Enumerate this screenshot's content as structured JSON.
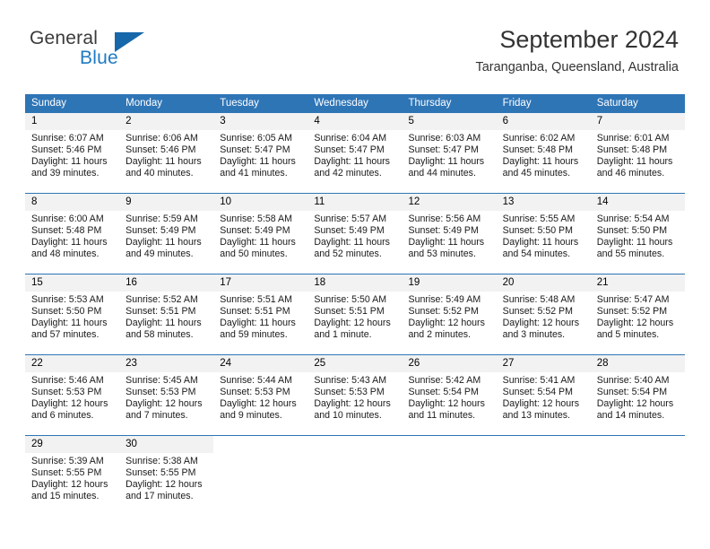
{
  "brand": {
    "name_top": "General",
    "name_bottom": "Blue",
    "accent_color": "#1f7ac4",
    "triangle_color": "#1767ab"
  },
  "header": {
    "month_title": "September 2024",
    "location": "Taranganba, Queensland, Australia"
  },
  "theme": {
    "header_blue": "#2e75b6",
    "daynum_band": "#f2f2f2"
  },
  "weekday_headers": [
    "Sunday",
    "Monday",
    "Tuesday",
    "Wednesday",
    "Thursday",
    "Friday",
    "Saturday"
  ],
  "weeks": [
    [
      {
        "day": "1",
        "sunrise": "Sunrise: 6:07 AM",
        "sunset": "Sunset: 5:46 PM",
        "daylight": "Daylight: 11 hours and 39 minutes."
      },
      {
        "day": "2",
        "sunrise": "Sunrise: 6:06 AM",
        "sunset": "Sunset: 5:46 PM",
        "daylight": "Daylight: 11 hours and 40 minutes."
      },
      {
        "day": "3",
        "sunrise": "Sunrise: 6:05 AM",
        "sunset": "Sunset: 5:47 PM",
        "daylight": "Daylight: 11 hours and 41 minutes."
      },
      {
        "day": "4",
        "sunrise": "Sunrise: 6:04 AM",
        "sunset": "Sunset: 5:47 PM",
        "daylight": "Daylight: 11 hours and 42 minutes."
      },
      {
        "day": "5",
        "sunrise": "Sunrise: 6:03 AM",
        "sunset": "Sunset: 5:47 PM",
        "daylight": "Daylight: 11 hours and 44 minutes."
      },
      {
        "day": "6",
        "sunrise": "Sunrise: 6:02 AM",
        "sunset": "Sunset: 5:48 PM",
        "daylight": "Daylight: 11 hours and 45 minutes."
      },
      {
        "day": "7",
        "sunrise": "Sunrise: 6:01 AM",
        "sunset": "Sunset: 5:48 PM",
        "daylight": "Daylight: 11 hours and 46 minutes."
      }
    ],
    [
      {
        "day": "8",
        "sunrise": "Sunrise: 6:00 AM",
        "sunset": "Sunset: 5:48 PM",
        "daylight": "Daylight: 11 hours and 48 minutes."
      },
      {
        "day": "9",
        "sunrise": "Sunrise: 5:59 AM",
        "sunset": "Sunset: 5:49 PM",
        "daylight": "Daylight: 11 hours and 49 minutes."
      },
      {
        "day": "10",
        "sunrise": "Sunrise: 5:58 AM",
        "sunset": "Sunset: 5:49 PM",
        "daylight": "Daylight: 11 hours and 50 minutes."
      },
      {
        "day": "11",
        "sunrise": "Sunrise: 5:57 AM",
        "sunset": "Sunset: 5:49 PM",
        "daylight": "Daylight: 11 hours and 52 minutes."
      },
      {
        "day": "12",
        "sunrise": "Sunrise: 5:56 AM",
        "sunset": "Sunset: 5:49 PM",
        "daylight": "Daylight: 11 hours and 53 minutes."
      },
      {
        "day": "13",
        "sunrise": "Sunrise: 5:55 AM",
        "sunset": "Sunset: 5:50 PM",
        "daylight": "Daylight: 11 hours and 54 minutes."
      },
      {
        "day": "14",
        "sunrise": "Sunrise: 5:54 AM",
        "sunset": "Sunset: 5:50 PM",
        "daylight": "Daylight: 11 hours and 55 minutes."
      }
    ],
    [
      {
        "day": "15",
        "sunrise": "Sunrise: 5:53 AM",
        "sunset": "Sunset: 5:50 PM",
        "daylight": "Daylight: 11 hours and 57 minutes."
      },
      {
        "day": "16",
        "sunrise": "Sunrise: 5:52 AM",
        "sunset": "Sunset: 5:51 PM",
        "daylight": "Daylight: 11 hours and 58 minutes."
      },
      {
        "day": "17",
        "sunrise": "Sunrise: 5:51 AM",
        "sunset": "Sunset: 5:51 PM",
        "daylight": "Daylight: 11 hours and 59 minutes."
      },
      {
        "day": "18",
        "sunrise": "Sunrise: 5:50 AM",
        "sunset": "Sunset: 5:51 PM",
        "daylight": "Daylight: 12 hours and 1 minute."
      },
      {
        "day": "19",
        "sunrise": "Sunrise: 5:49 AM",
        "sunset": "Sunset: 5:52 PM",
        "daylight": "Daylight: 12 hours and 2 minutes."
      },
      {
        "day": "20",
        "sunrise": "Sunrise: 5:48 AM",
        "sunset": "Sunset: 5:52 PM",
        "daylight": "Daylight: 12 hours and 3 minutes."
      },
      {
        "day": "21",
        "sunrise": "Sunrise: 5:47 AM",
        "sunset": "Sunset: 5:52 PM",
        "daylight": "Daylight: 12 hours and 5 minutes."
      }
    ],
    [
      {
        "day": "22",
        "sunrise": "Sunrise: 5:46 AM",
        "sunset": "Sunset: 5:53 PM",
        "daylight": "Daylight: 12 hours and 6 minutes."
      },
      {
        "day": "23",
        "sunrise": "Sunrise: 5:45 AM",
        "sunset": "Sunset: 5:53 PM",
        "daylight": "Daylight: 12 hours and 7 minutes."
      },
      {
        "day": "24",
        "sunrise": "Sunrise: 5:44 AM",
        "sunset": "Sunset: 5:53 PM",
        "daylight": "Daylight: 12 hours and 9 minutes."
      },
      {
        "day": "25",
        "sunrise": "Sunrise: 5:43 AM",
        "sunset": "Sunset: 5:53 PM",
        "daylight": "Daylight: 12 hours and 10 minutes."
      },
      {
        "day": "26",
        "sunrise": "Sunrise: 5:42 AM",
        "sunset": "Sunset: 5:54 PM",
        "daylight": "Daylight: 12 hours and 11 minutes."
      },
      {
        "day": "27",
        "sunrise": "Sunrise: 5:41 AM",
        "sunset": "Sunset: 5:54 PM",
        "daylight": "Daylight: 12 hours and 13 minutes."
      },
      {
        "day": "28",
        "sunrise": "Sunrise: 5:40 AM",
        "sunset": "Sunset: 5:54 PM",
        "daylight": "Daylight: 12 hours and 14 minutes."
      }
    ],
    [
      {
        "day": "29",
        "sunrise": "Sunrise: 5:39 AM",
        "sunset": "Sunset: 5:55 PM",
        "daylight": "Daylight: 12 hours and 15 minutes."
      },
      {
        "day": "30",
        "sunrise": "Sunrise: 5:38 AM",
        "sunset": "Sunset: 5:55 PM",
        "daylight": "Daylight: 12 hours and 17 minutes."
      },
      {
        "day": "",
        "sunrise": "",
        "sunset": "",
        "daylight": ""
      },
      {
        "day": "",
        "sunrise": "",
        "sunset": "",
        "daylight": ""
      },
      {
        "day": "",
        "sunrise": "",
        "sunset": "",
        "daylight": ""
      },
      {
        "day": "",
        "sunrise": "",
        "sunset": "",
        "daylight": ""
      },
      {
        "day": "",
        "sunrise": "",
        "sunset": "",
        "daylight": ""
      }
    ]
  ]
}
